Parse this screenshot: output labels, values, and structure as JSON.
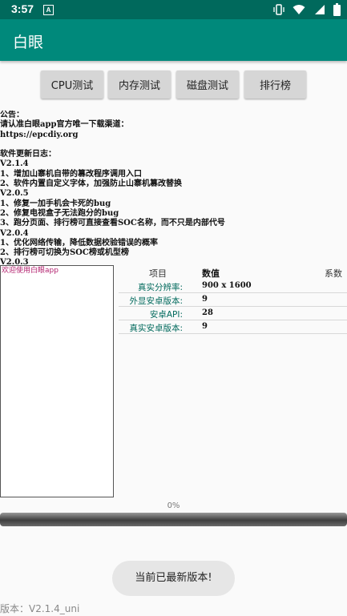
{
  "status_bar": {
    "time": "3:57",
    "notification_letter": "A",
    "icons": [
      "vibrate-icon",
      "wifi-icon",
      "signal-icon",
      "battery-icon"
    ]
  },
  "app_bar": {
    "title": "白眼"
  },
  "tests": {
    "cpu_label": "CPU测试",
    "memory_label": "内存测试",
    "disk_label": "磁盘测试",
    "ranking_label": "排行榜"
  },
  "notice": {
    "text": "公告：\n请认准白眼app官方唯一下载渠道：\nhttps://epcdiy.org\n\n软件更新日志：\nV2.1.4\n1、增加山寨机自带的篡改程序调用入口\n2、软件内置自定义字体，加强防止山寨机篡改替换\nV2.0.5\n1、修复一加手机会卡死的bug\n2、修复电视盒子无法跑分的bug\n3、跑分页面、排行榜可直接查看SOC名称，而不只是内部代号\nV2.0.4\n1、优化网络传输，降低数据校验错误的概率\n2、排行榜可切换为SOC榜或机型榜\nV2.0.3"
  },
  "log": {
    "text": "欢迎使用白眼app"
  },
  "info_table": {
    "headers": {
      "item": "项目",
      "value": "数值",
      "coef": "系数"
    },
    "rows": [
      {
        "key": "真实分辨率:",
        "value": "900 x 1600"
      },
      {
        "key": "外显安卓版本:",
        "value": "9"
      },
      {
        "key": "安卓API:",
        "value": "28"
      },
      {
        "key": "真实安卓版本:",
        "value": "9"
      }
    ]
  },
  "progress": {
    "percent_label": "0%",
    "value": 0
  },
  "toast": {
    "text": "当前已最新版本!"
  },
  "footer": {
    "version": "版本：V2.1.4_uni"
  },
  "colors": {
    "primary_dark": "#00695c",
    "primary": "#00897b",
    "log_text": "#b3226f"
  }
}
